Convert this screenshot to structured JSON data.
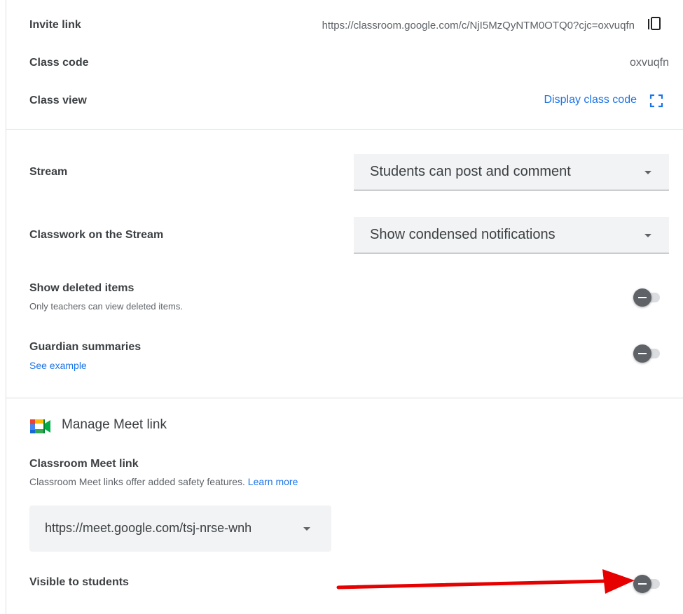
{
  "class_info": {
    "invite_link_label": "Invite link",
    "invite_link_value": "https://classroom.google.com/c/NjI5MzQyNTM0OTQ0?cjc=oxvuqfn",
    "class_code_label": "Class code",
    "class_code_value": "oxvuqfn",
    "class_view_label": "Class view",
    "display_class_code_label": "Display class code"
  },
  "general": {
    "stream_label": "Stream",
    "stream_value": "Students can post and comment",
    "classwork_label": "Classwork on the Stream",
    "classwork_value": "Show condensed notifications",
    "deleted_label": "Show deleted items",
    "deleted_sub": "Only teachers can view deleted items.",
    "guardian_label": "Guardian summaries",
    "guardian_link": "See example"
  },
  "meet": {
    "title": "Manage Meet link",
    "classroom_meet_label": "Classroom Meet link",
    "classroom_meet_sub": "Classroom Meet links offer added safety features.",
    "learn_more": "Learn more",
    "meet_url": "https://meet.google.com/tsj-nrse-wnh",
    "visible_label": "Visible to students"
  },
  "toggles": {
    "show_deleted_items": false,
    "guardian_summaries": false,
    "visible_to_students": false
  },
  "colors": {
    "accent": "#1a73e8",
    "annotation_arrow": "#e60000",
    "toggle_off_knob": "#5f6368"
  },
  "icons": [
    "copy-icon",
    "fullscreen-icon",
    "meet-logo-icon",
    "dropdown-caret-icon"
  ]
}
